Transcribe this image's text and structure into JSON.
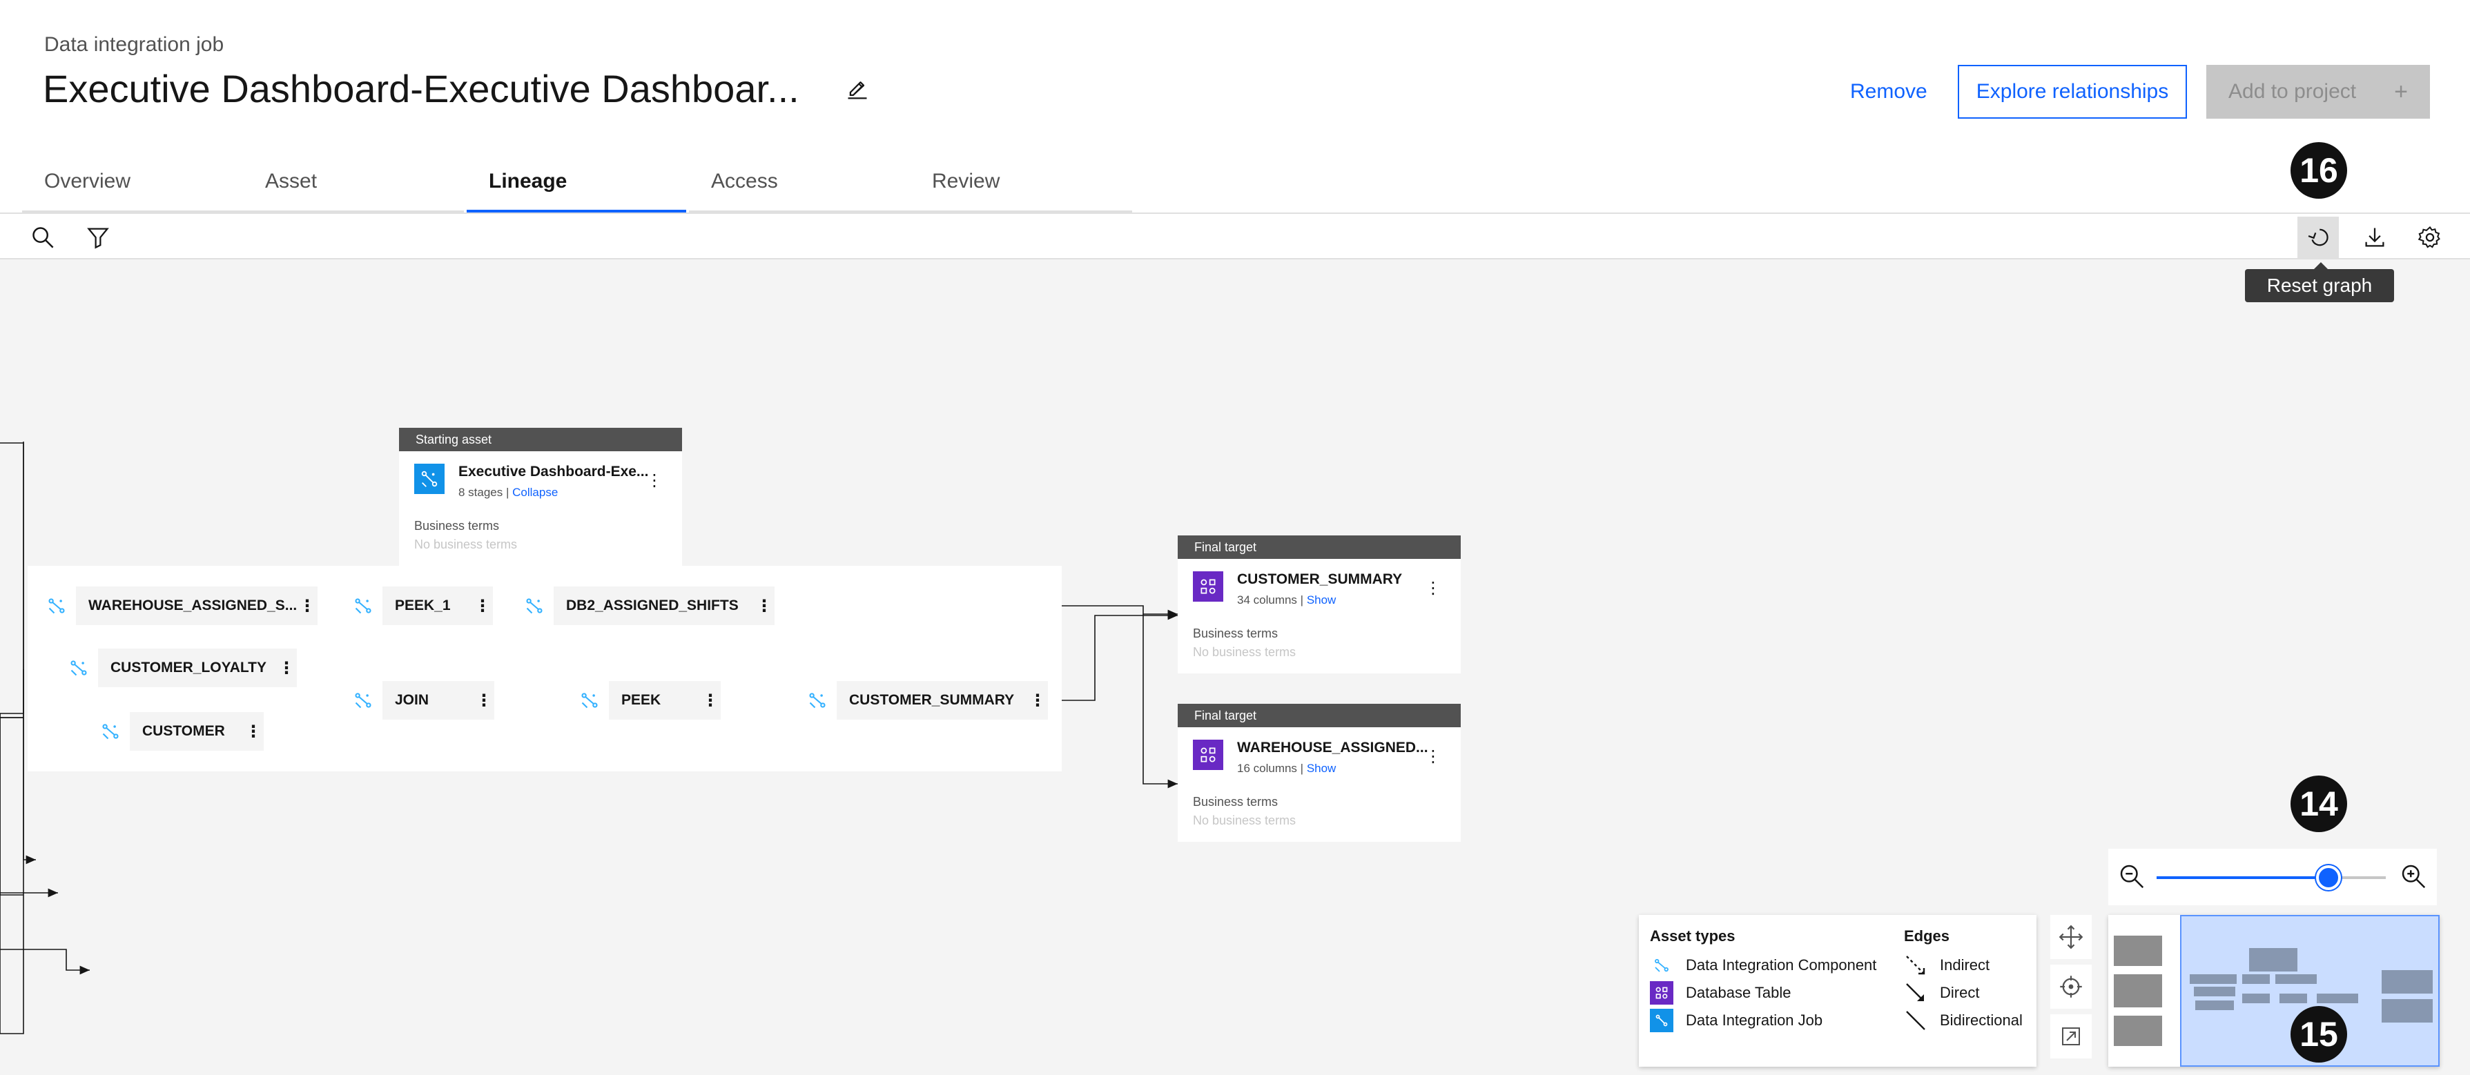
{
  "header": {
    "subtitle": "Data integration job",
    "title": "Executive Dashboard-Executive Dashboar...",
    "remove_label": "Remove",
    "explore_label": "Explore relationships",
    "add_label": "Add to project",
    "add_icon": "+"
  },
  "tabs": [
    {
      "label": "Overview"
    },
    {
      "label": "Asset"
    },
    {
      "label": "Lineage",
      "active": true
    },
    {
      "label": "Access"
    },
    {
      "label": "Review"
    }
  ],
  "toolbar": {
    "tooltip": "Reset graph"
  },
  "markers": {
    "m16": "16",
    "m14": "14",
    "m15": "15"
  },
  "starting_asset": {
    "header": "Starting asset",
    "name": "Executive Dashboard-Exe...",
    "stages": "8 stages",
    "separator": " | ",
    "collapse": "Collapse",
    "business_terms": "Business terms",
    "no_terms": "No business terms"
  },
  "nodes": {
    "warehouse_assigned": "WAREHOUSE_ASSIGNED_S...",
    "peek_1": "PEEK_1",
    "db2_assigned_shifts": "DB2_ASSIGNED_SHIFTS",
    "customer_loyalty": "CUSTOMER_LOYALTY",
    "customer": "CUSTOMER",
    "join": "JOIN",
    "peek": "PEEK",
    "customer_summary": "CUSTOMER_SUMMARY",
    "menu": "⋮"
  },
  "targets": [
    {
      "header": "Final target",
      "name": "CUSTOMER_SUMMARY",
      "meta": "34 columns",
      "separator": " | ",
      "link": "Show",
      "business_terms": "Business terms",
      "no_terms": "No business terms"
    },
    {
      "header": "Final target",
      "name": "WAREHOUSE_ASSIGNED...",
      "meta": "16 columns",
      "separator": " | ",
      "link": "Show",
      "business_terms": "Business terms",
      "no_terms": "No business terms"
    }
  ],
  "legend": {
    "asset_types_title": "Asset types",
    "edges_title": "Edges",
    "asset_types": [
      {
        "label": "Data Integration Component",
        "icon": "data-integration-component-icon"
      },
      {
        "label": "Database Table",
        "icon": "database-table-icon"
      },
      {
        "label": "Data Integration Job",
        "icon": "data-integration-job-icon"
      }
    ],
    "edges": [
      {
        "label": "Indirect",
        "icon": "indirect-edge-icon"
      },
      {
        "label": "Direct",
        "icon": "direct-edge-icon"
      },
      {
        "label": "Bidirectional",
        "icon": "bidirectional-edge-icon"
      }
    ]
  },
  "zoom": {
    "level": 0.75
  },
  "colors": {
    "accent": "#0f62fe",
    "table_purple": "#6929c4",
    "job_blue": "#1192e8",
    "component_cyan": "#33b1ff"
  }
}
